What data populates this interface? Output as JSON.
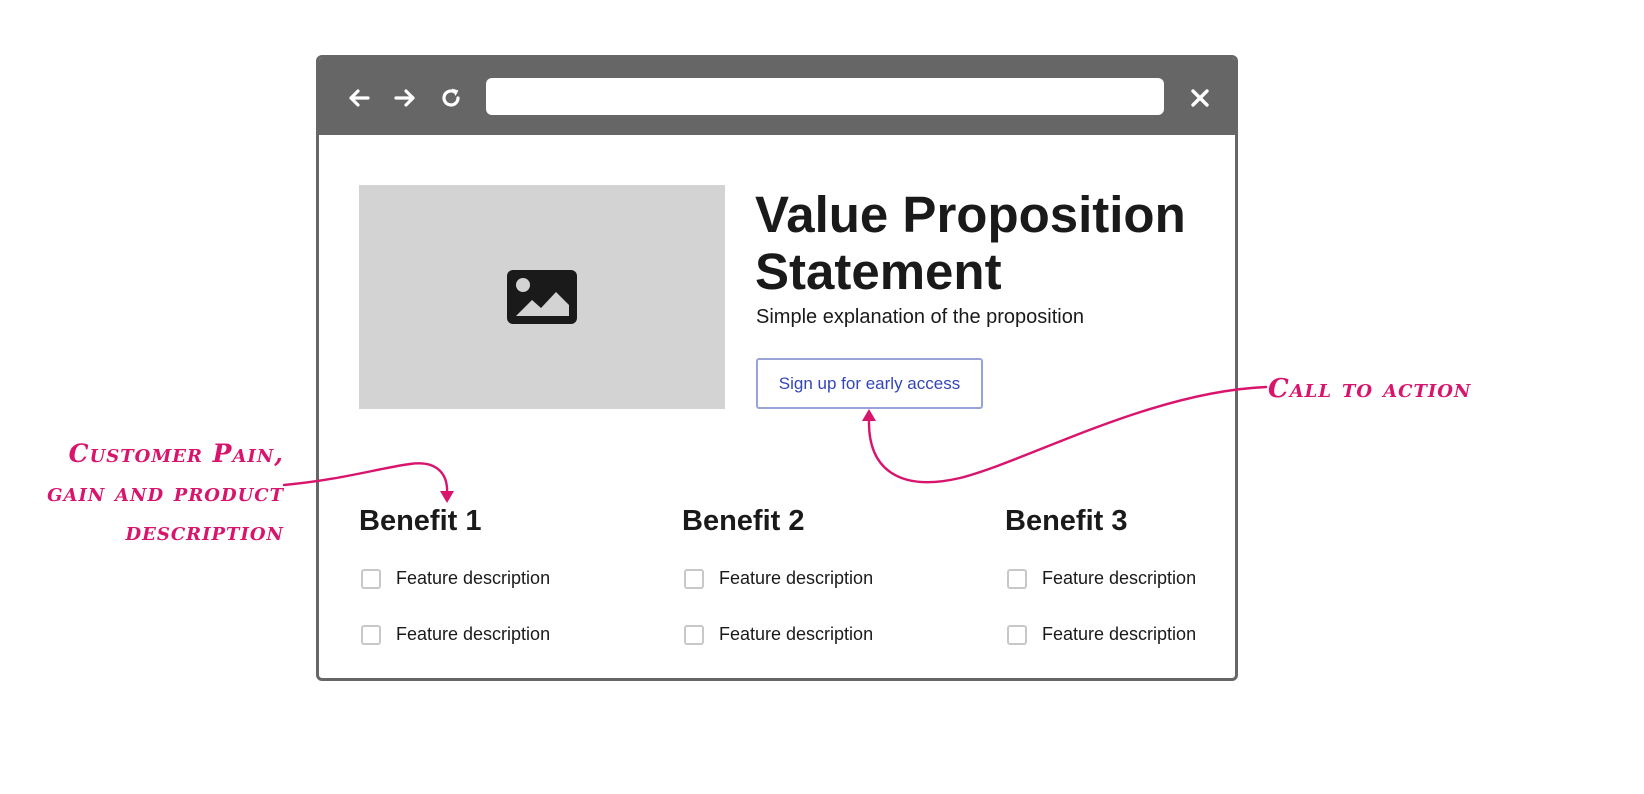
{
  "browser": {
    "url": "",
    "nav_icons": [
      "back-arrow-icon",
      "forward-arrow-icon",
      "reload-icon"
    ],
    "close_icon": "close-icon"
  },
  "hero": {
    "image_icon": "image-icon",
    "headline": "Value Proposition Statement",
    "subtext": "Simple explanation of the proposition",
    "cta_label": "Sign up for early access"
  },
  "benefits": [
    {
      "title": "Benefit 1",
      "features": [
        "Feature description",
        "Feature description"
      ]
    },
    {
      "title": "Benefit 2",
      "features": [
        "Feature description",
        "Feature description"
      ]
    },
    {
      "title": "Benefit 3",
      "features": [
        "Feature description",
        "Feature description"
      ]
    }
  ],
  "annotations": {
    "left": [
      "Customer Pain,",
      "gain and product",
      "description"
    ],
    "right": "Call to action",
    "color": "#d8146d"
  },
  "colors": {
    "toolbar": "#666666",
    "image_placeholder": "#d3d3d3",
    "cta_text": "#3346b8",
    "cta_border": "#9aa3d8"
  }
}
